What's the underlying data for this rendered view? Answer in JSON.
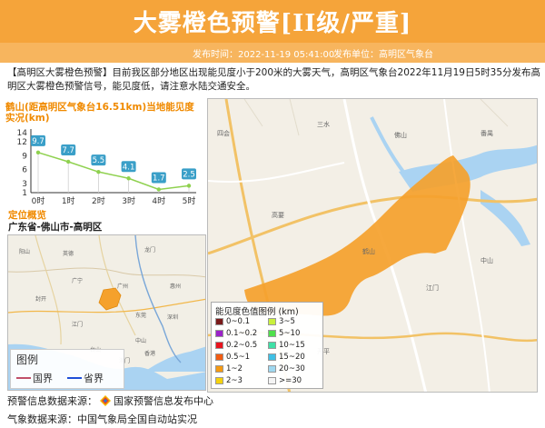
{
  "header": {
    "title": "大雾橙色预警[II级/严重]",
    "publish_time": "发布时间：2022-11-19 05:41:00",
    "publisher": "发布单位：高明区气象台"
  },
  "notice": "【高明区大雾橙色预警】目前我区部分地区出现能见度小于200米的大雾天气，高明区气象台2022年11月19日5时35分发布高明区大雾橙色预警信号，能见度低，请注意水陆交通安全。",
  "chart_title": "鹤山(距高明区气象台16.51km)当地能见度实况(km)",
  "chart_data": {
    "type": "line",
    "title": "鹤山(距高明区气象台16.51km)当地能见度实况(km)",
    "categories": [
      "0时",
      "1时",
      "2时",
      "3时",
      "4时",
      "5时"
    ],
    "values": [
      9.7,
      7.7,
      5.5,
      4.1,
      1.7,
      2.5
    ],
    "value_labels": [
      "9.7",
      "7.7",
      "5.5",
      "4.1",
      "1.7",
      "2.5"
    ],
    "yticks": [
      "1",
      "3",
      "6",
      "9",
      "12",
      "14"
    ],
    "ylim": [
      1,
      14
    ],
    "line_color": "#8fd14f",
    "label_color": "#3a9fc8"
  },
  "location": {
    "label": "定位概览",
    "value": "广东省-佛山市-高明区"
  },
  "small_map_legend": {
    "title": "图例",
    "items": [
      {
        "label": "国界",
        "color": "#c0506a"
      },
      {
        "label": "省界",
        "color": "#1f4fd8"
      }
    ]
  },
  "visibility_legend": {
    "title": "能见度色值图例 (km)",
    "items": [
      {
        "label": "0~0.1",
        "color": "#7a1a1a"
      },
      {
        "label": "0.1~0.2",
        "color": "#9b22c8"
      },
      {
        "label": "0.2~0.5",
        "color": "#e8141e"
      },
      {
        "label": "0.5~1",
        "color": "#f25c12"
      },
      {
        "label": "1~2",
        "color": "#f59a12"
      },
      {
        "label": "2~3",
        "color": "#f5d20e"
      },
      {
        "label": "3~5",
        "color": "#c9f03c"
      },
      {
        "label": "5~10",
        "color": "#4fe04a"
      },
      {
        "label": "10~15",
        "color": "#3fe0a5"
      },
      {
        "label": "15~20",
        "color": "#3fbfe4"
      },
      {
        "label": "20~30",
        "color": "#9fd8f0"
      },
      {
        "label": ">=30",
        "color": "#f4f4f4"
      }
    ]
  },
  "footer": {
    "warning_source": "预警信息数据来源：",
    "warning_source_name": "国家预警信息发布中心",
    "weather_source": "气象数据来源：中国气象局全国自动站实况"
  },
  "colors": {
    "header": "#f5a43a",
    "fog_area": "#f5a12c",
    "accent": "#f08a00"
  }
}
